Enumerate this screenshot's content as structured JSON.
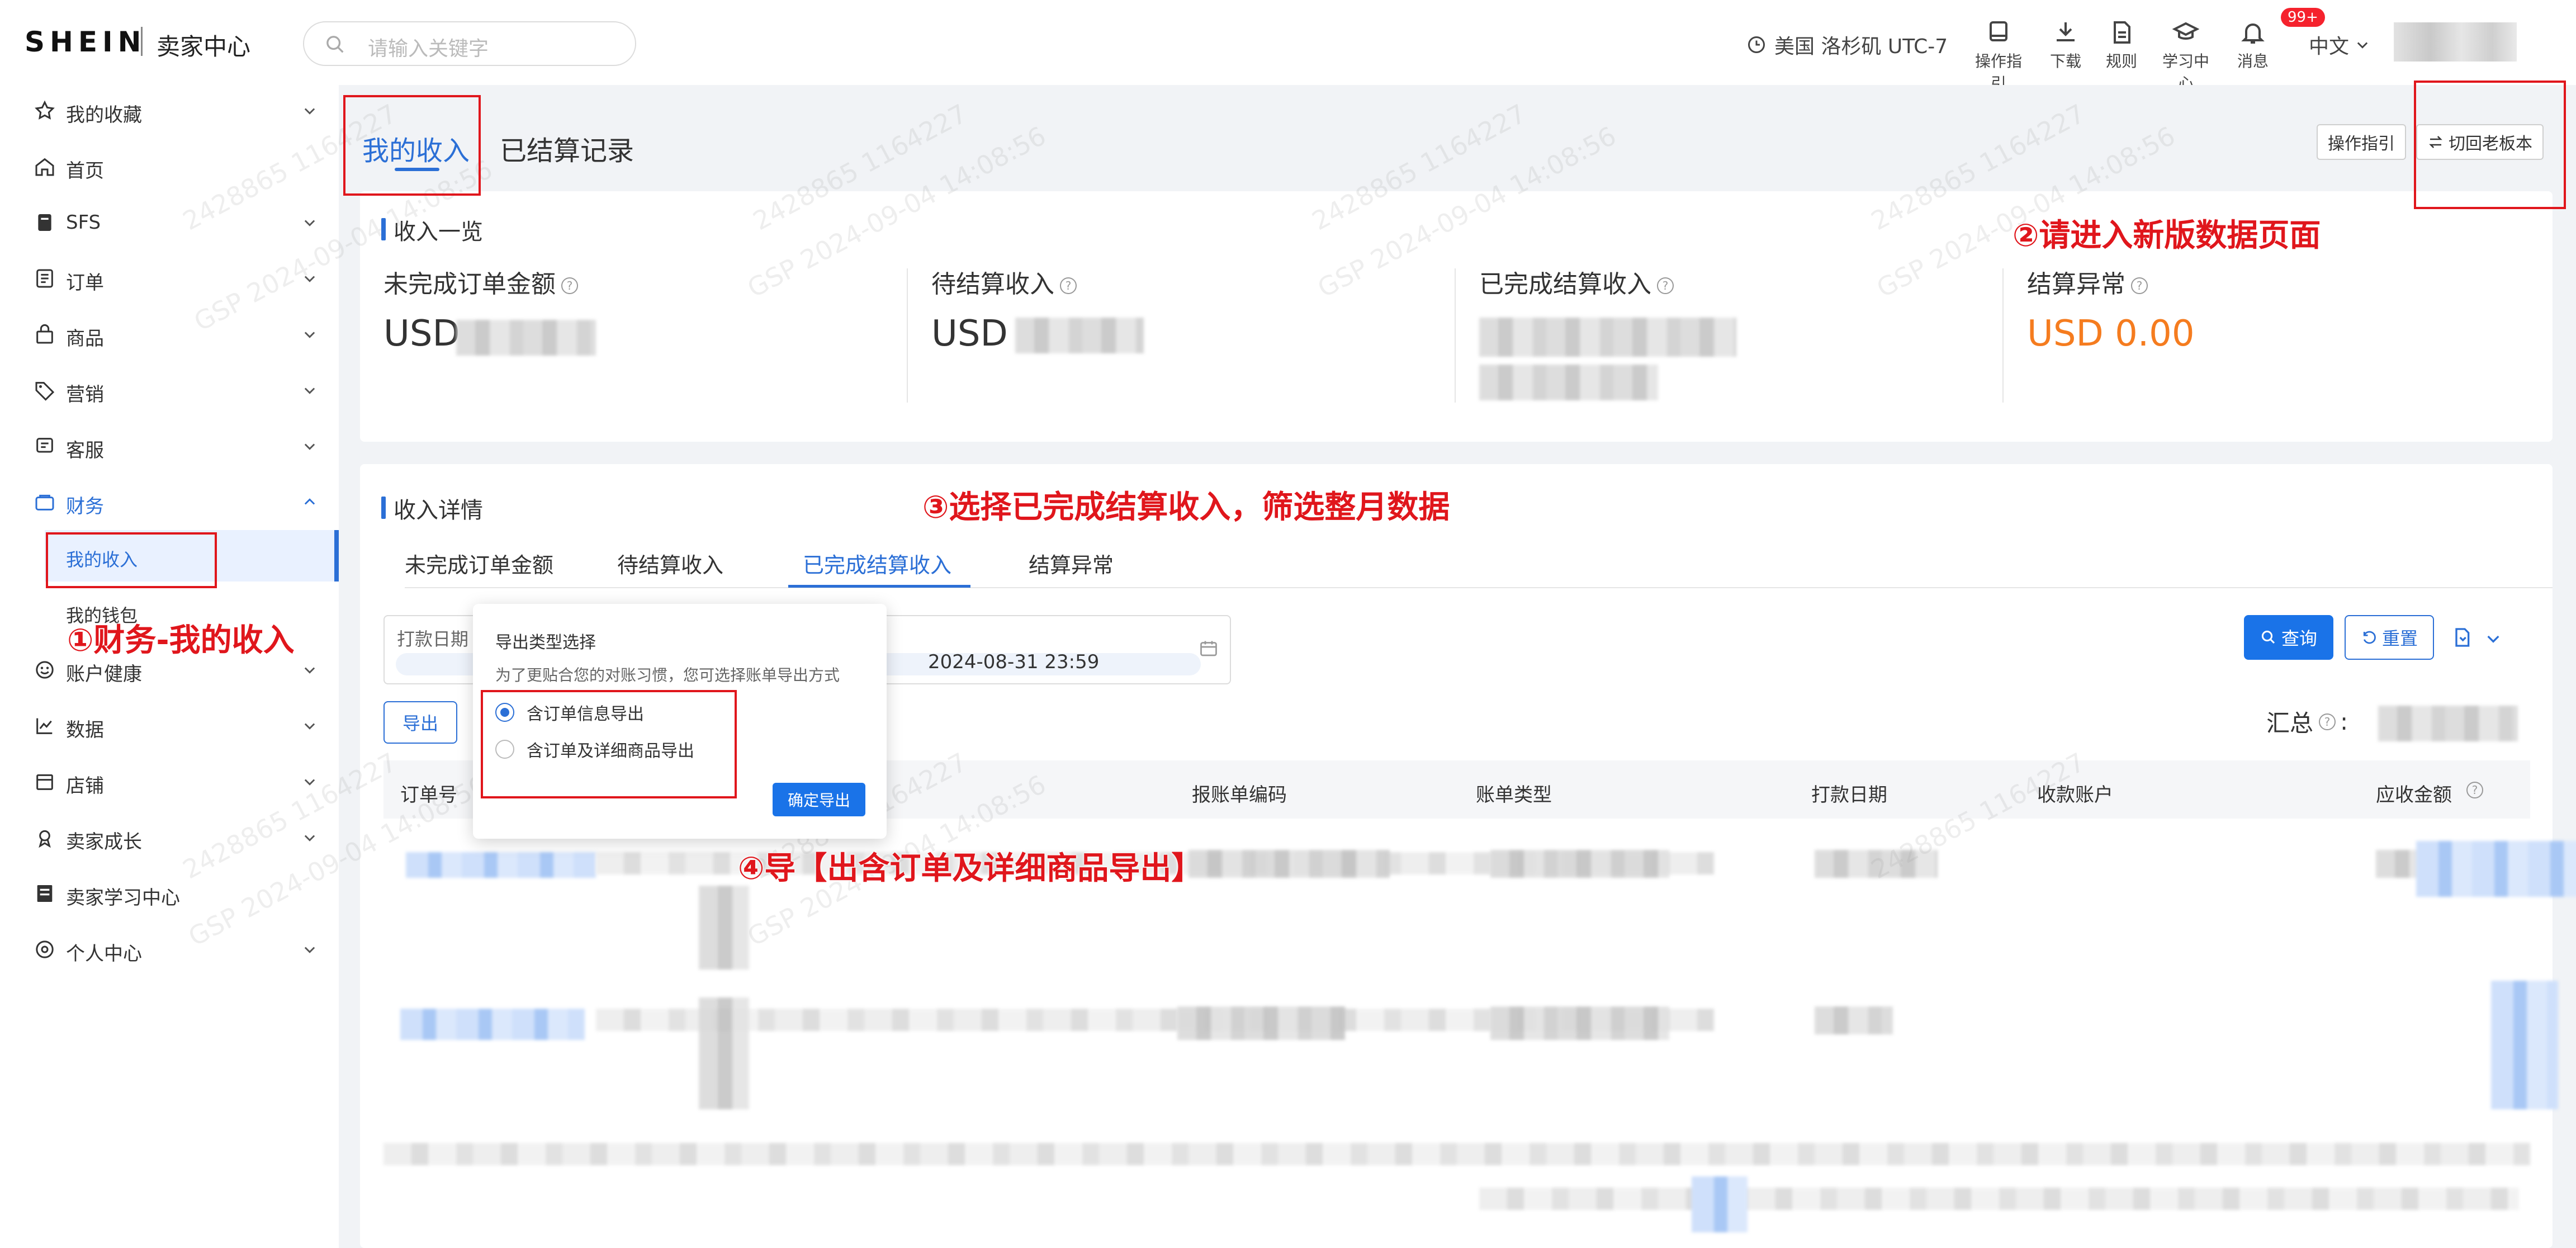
{
  "topbar": {
    "brand": "SHEIN",
    "brand_sub": "卖家中心",
    "search_placeholder": "请输入关键字",
    "timezone": "美国 洛杉矶 UTC-7",
    "tools": [
      {
        "label": "操作指引",
        "icon": "book-icon"
      },
      {
        "label": "下载",
        "icon": "download-icon"
      },
      {
        "label": "规则",
        "icon": "document-icon"
      },
      {
        "label": "学习中心",
        "icon": "graduation-cap-icon"
      },
      {
        "label": "消息",
        "icon": "bell-icon"
      }
    ],
    "badge": "99+",
    "language": "中文"
  },
  "sidebar": {
    "items": [
      {
        "label": "我的收藏",
        "icon": "star-icon"
      },
      {
        "label": "首页",
        "icon": "home-icon"
      },
      {
        "label": "SFS",
        "icon": "doc-icon"
      },
      {
        "label": "订单",
        "icon": "list-icon"
      },
      {
        "label": "商品",
        "icon": "bag-icon"
      },
      {
        "label": "营销",
        "icon": "tag-icon"
      },
      {
        "label": "客服",
        "icon": "chat-icon"
      },
      {
        "label": "财务",
        "icon": "finance-icon"
      },
      {
        "label": "账户健康",
        "icon": "health-icon"
      },
      {
        "label": "数据",
        "icon": "chart-icon"
      },
      {
        "label": "店铺",
        "icon": "store-icon"
      },
      {
        "label": "卖家成长",
        "icon": "medal-icon"
      },
      {
        "label": "卖家学习中心",
        "icon": "study-icon"
      },
      {
        "label": "个人中心",
        "icon": "user-icon"
      }
    ],
    "finance_sub": [
      "我的收入",
      "我的钱包"
    ]
  },
  "main": {
    "tabs": [
      "我的收入",
      "已结算记录"
    ],
    "guide_btn": "操作指引",
    "switch_btn": "切回老板本",
    "overview_title": "收入一览",
    "summary": [
      {
        "label": "未完成订单金额",
        "value": "USD"
      },
      {
        "label": "待结算收入",
        "value": "USD"
      },
      {
        "label": "已完成结算收入",
        "value": ""
      },
      {
        "label": "结算异常",
        "value": "USD 0.00"
      }
    ],
    "detail_title": "收入详情",
    "detail_tabs": [
      "未完成订单金额",
      "待结算收入",
      "已完成结算收入",
      "结算异常"
    ],
    "date_label": "打款日期",
    "date_end": "2024-08-31 23:59",
    "query_btn": "查询",
    "reset_btn": "重置",
    "export_btn": "导出",
    "total_label": "汇总",
    "columns": [
      "订单号",
      "报账单编码",
      "账单类型",
      "打款日期",
      "收款账户",
      "应收金额"
    ]
  },
  "popup": {
    "title": "导出类型选择",
    "desc": "为了更贴合您的对账习惯，您可选择账单导出方式",
    "options": [
      "含订单信息导出",
      "含订单及详细商品导出"
    ],
    "selected": 0,
    "confirm": "确定导出"
  },
  "annotations": {
    "a1": "①财务-我的收入",
    "a2": "②请进入新版数据页面",
    "a3": "③选择已完成结算收入，筛选整月数据",
    "a4": "④导【出含订单及详细商品导出】"
  },
  "watermark": [
    "2428865 1164227",
    "GSP 2024-09-04 14:08:56"
  ],
  "colors": {
    "accent": "#2b6fd6",
    "orange": "#f57c1f",
    "annotation": "#e0161c"
  }
}
